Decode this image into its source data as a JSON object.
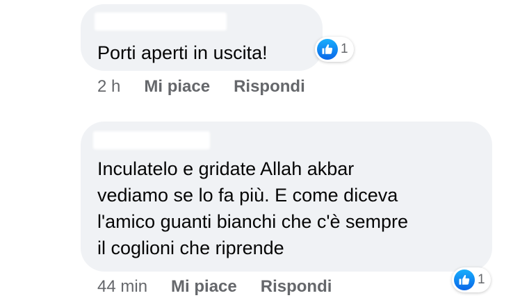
{
  "comments": [
    {
      "text": "Porti aperti in uscita!",
      "reaction_count": "1",
      "time": "2 h",
      "like_label": "Mi piace",
      "reply_label": "Rispondi"
    },
    {
      "text": "Inculatelo e gridate Allah akbar\nvediamo se lo fa più. E come diceva\nl'amico guanti bianchi che c'è sempre\nil coglioni che riprende",
      "reaction_count": "1",
      "time": "44 min",
      "like_label": "Mi piace",
      "reply_label": "Rispondi"
    }
  ],
  "colors": {
    "bubble": "#f0f2f5",
    "meta_text": "#65676b",
    "like_blue": "#1877f2"
  },
  "icons": {
    "reaction": "thumbs-up-icon"
  }
}
